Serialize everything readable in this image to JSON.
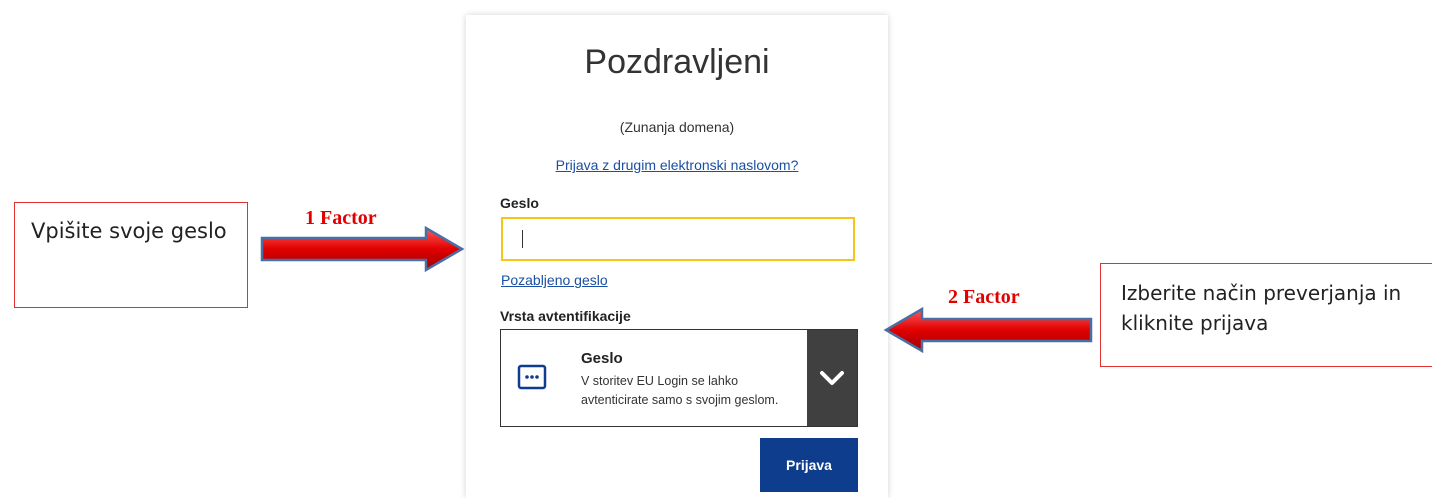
{
  "login": {
    "title": "Pozdravljeni",
    "domain": "(Zunanja domena)",
    "switch_link": "Prijava z drugim elektronski naslovom?",
    "password_label": "Geslo",
    "password_value": "",
    "forgot_link": "Pozabljeno geslo",
    "auth_type_label": "Vrsta avtentifikacije",
    "auth_option": {
      "title": "Geslo",
      "description": "V storitev EU Login se lahko avtenticirate samo s svojim geslom.",
      "icon": "password-dots-icon"
    },
    "submit_label": "Prijava"
  },
  "annotations": {
    "left_note": "Vpišite svoje geslo",
    "right_note": "Izberite način preverjanja in kliknite prijava",
    "factor_1": "1 Factor",
    "factor_2": "2 Factor"
  },
  "colors": {
    "link": "#1a4fa3",
    "input_focus_border": "#f5c518",
    "submit_bg": "#0d3d8c",
    "toggle_bg": "#404040",
    "arrow_red": "#e00000",
    "note_border": "#e03030"
  }
}
